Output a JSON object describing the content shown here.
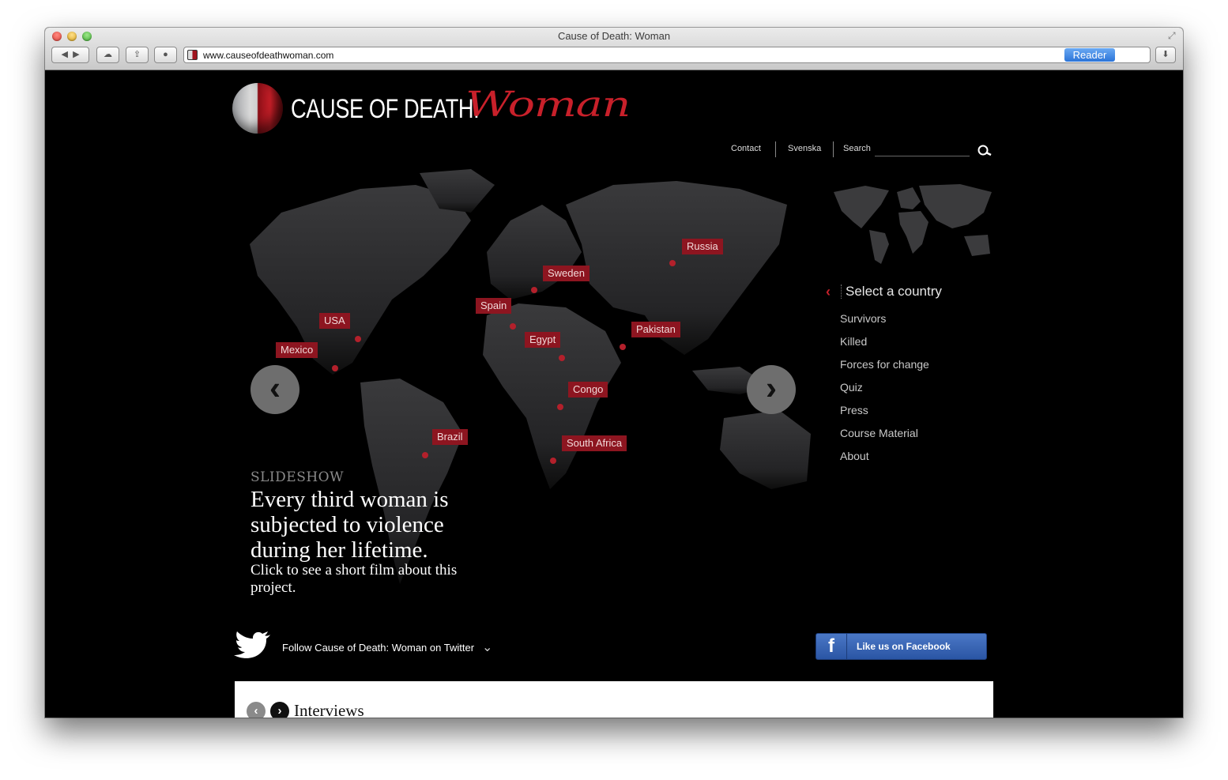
{
  "browser": {
    "window_title": "Cause of Death: Woman",
    "url": "www.causeofdeathwoman.com",
    "reader_label": "Reader"
  },
  "site": {
    "logo_text": "CAUSE OF DEATH:",
    "logo_script": "Woman",
    "top_links": [
      "Contact",
      "Svenska"
    ],
    "search_label": "Search"
  },
  "map": {
    "pins": [
      {
        "label": "Russia"
      },
      {
        "label": "Sweden"
      },
      {
        "label": "Spain"
      },
      {
        "label": "USA"
      },
      {
        "label": "Mexico"
      },
      {
        "label": "Egypt"
      },
      {
        "label": "Pakistan"
      },
      {
        "label": "Congo"
      },
      {
        "label": "Brazil"
      },
      {
        "label": "South Africa"
      }
    ]
  },
  "slideshow": {
    "kicker": "SLIDESHOW",
    "title": "Every third woman is subjected to violence during her lifetime.",
    "subtitle": "Click to see a short film about this project."
  },
  "sidebar": {
    "select_country": "Select a country",
    "items": [
      "Survivors",
      "Killed",
      "Forces for change",
      "Quiz",
      "Press",
      "Course Material",
      "About"
    ]
  },
  "social": {
    "twitter_text": "Follow Cause of Death: Woman on Twitter",
    "facebook_text": "Like us on Facebook"
  },
  "interviews": {
    "title": "Interviews"
  },
  "colors": {
    "accent_red": "#c8202a",
    "pin_bg": "#8d1520",
    "facebook_blue": "#3b5fb0"
  }
}
